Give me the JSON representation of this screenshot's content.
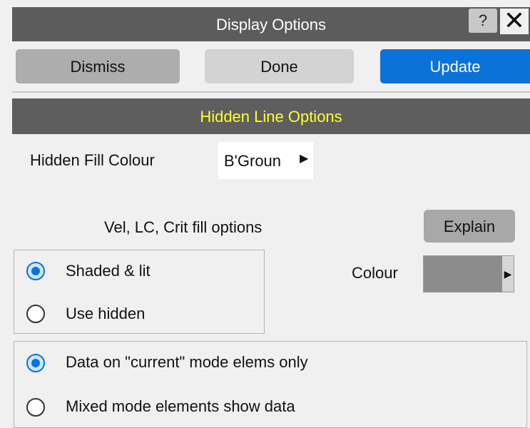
{
  "window": {
    "title": "Display Options",
    "help_label": "?",
    "close_label": "✕"
  },
  "toolbar": {
    "dismiss_label": "Dismiss",
    "done_label": "Done",
    "update_label": "Update"
  },
  "section": {
    "header": "Hidden Line Options"
  },
  "hidden_fill": {
    "label": "Hidden Fill Colour",
    "value": "B'Groun",
    "arrow": "▶"
  },
  "fill_options": {
    "label": "Vel, LC, Crit fill options",
    "explain_label": "Explain"
  },
  "shading_group": {
    "options": [
      {
        "label": "Shaded & lit",
        "selected": true
      },
      {
        "label": "Use hidden",
        "selected": false
      }
    ]
  },
  "colour": {
    "label": "Colour",
    "swatch_color": "#8c8c8c",
    "arrow": "▶"
  },
  "mode_group": {
    "options": [
      {
        "label": "Data on \"current\" mode elems only",
        "selected": true
      },
      {
        "label": "Mixed mode elements show data",
        "selected": false
      }
    ]
  },
  "colors": {
    "accent": "#0a72d9",
    "header_bg": "#5e5e5e",
    "header_text": "#ffff33"
  }
}
